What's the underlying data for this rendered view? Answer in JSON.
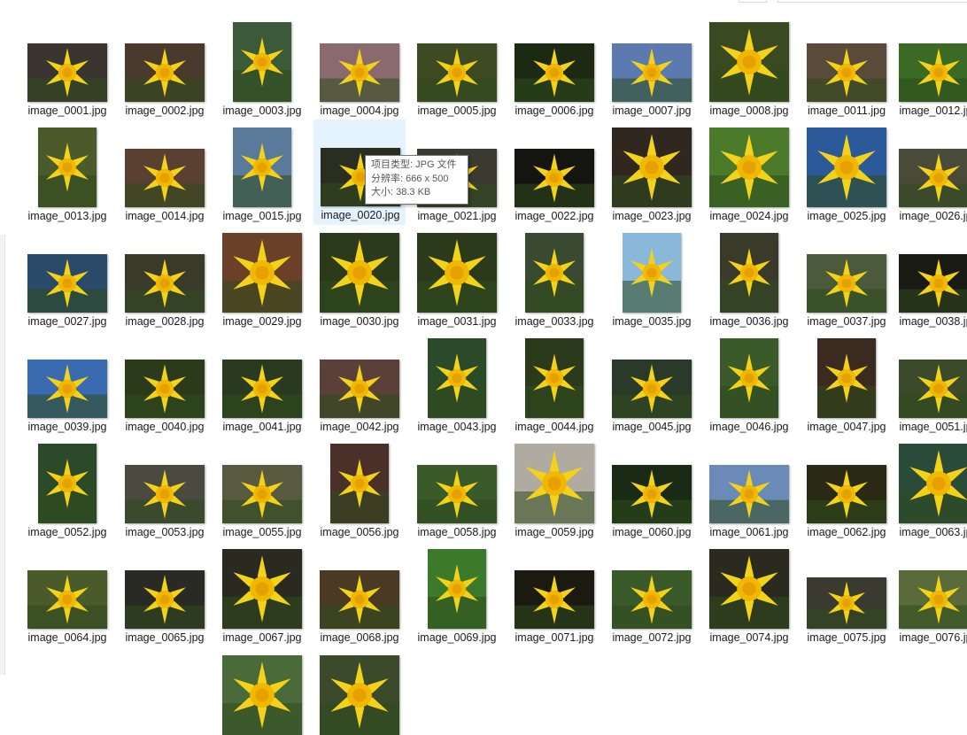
{
  "files": [
    {
      "name": "image_0001.jpg",
      "bg": "#3a3530",
      "thumb": "l"
    },
    {
      "name": "image_0002.jpg",
      "bg": "#4a3a2e",
      "thumb": "l"
    },
    {
      "name": "image_0003.jpg",
      "bg": "#3c5a3a",
      "thumb": "p"
    },
    {
      "name": "image_0004.jpg",
      "bg": "#8a6a6e",
      "thumb": "l"
    },
    {
      "name": "image_0005.jpg",
      "bg": "#3e4a22",
      "thumb": "l"
    },
    {
      "name": "image_0006.jpg",
      "bg": "#1c2a14",
      "thumb": "l"
    },
    {
      "name": "image_0007.jpg",
      "bg": "#5a7ab0",
      "thumb": "l"
    },
    {
      "name": "image_0008.jpg",
      "bg": "#3a4a20",
      "thumb": "sq"
    },
    {
      "name": "image_0011.jpg",
      "bg": "#5a4a3a",
      "thumb": "l"
    },
    {
      "name": "image_0012.jpg",
      "bg": "#3a6a24",
      "thumb": "l"
    },
    {
      "name": "image_0013.jpg",
      "bg": "#4a5a2a",
      "thumb": "p"
    },
    {
      "name": "image_0014.jpg",
      "bg": "#5a4030",
      "thumb": "l"
    },
    {
      "name": "image_0015.jpg",
      "bg": "#5a7a9a",
      "thumb": "p"
    },
    {
      "name": "image_0020.jpg",
      "bg": "#2a2e20",
      "thumb": "l"
    },
    {
      "name": "image_0021.jpg",
      "bg": "#3a3a30",
      "thumb": "l"
    },
    {
      "name": "image_0022.jpg",
      "bg": "#141410",
      "thumb": "l"
    },
    {
      "name": "image_0023.jpg",
      "bg": "#302820",
      "thumb": "sq"
    },
    {
      "name": "image_0024.jpg",
      "bg": "#4a7a2a",
      "thumb": "sq"
    },
    {
      "name": "image_0025.jpg",
      "bg": "#2a5a9a",
      "thumb": "sq"
    },
    {
      "name": "image_0026.jpg",
      "bg": "#4a4a3a",
      "thumb": "l"
    },
    {
      "name": "image_0027.jpg",
      "bg": "#2a4a6a",
      "thumb": "l"
    },
    {
      "name": "image_0028.jpg",
      "bg": "#3a3a2a",
      "thumb": "l"
    },
    {
      "name": "image_0029.jpg",
      "bg": "#6a4028",
      "thumb": "sq"
    },
    {
      "name": "image_0030.jpg",
      "bg": "#2a3a1a",
      "thumb": "sq"
    },
    {
      "name": "image_0031.jpg",
      "bg": "#2a3a1a",
      "thumb": "sq"
    },
    {
      "name": "image_0033.jpg",
      "bg": "#3a4a30",
      "thumb": "p"
    },
    {
      "name": "image_0035.jpg",
      "bg": "#8ab8d8",
      "thumb": "p"
    },
    {
      "name": "image_0036.jpg",
      "bg": "#3a3a2a",
      "thumb": "p"
    },
    {
      "name": "image_0037.jpg",
      "bg": "#4a5a3a",
      "thumb": "l"
    },
    {
      "name": "image_0038.jpg",
      "bg": "#1a1a14",
      "thumb": "l"
    },
    {
      "name": "image_0039.jpg",
      "bg": "#3a6ab0",
      "thumb": "l"
    },
    {
      "name": "image_0040.jpg",
      "bg": "#2a3a1a",
      "thumb": "l"
    },
    {
      "name": "image_0041.jpg",
      "bg": "#2a3a20",
      "thumb": "l"
    },
    {
      "name": "image_0042.jpg",
      "bg": "#5a4038",
      "thumb": "l"
    },
    {
      "name": "image_0043.jpg",
      "bg": "#2a4a2a",
      "thumb": "p"
    },
    {
      "name": "image_0044.jpg",
      "bg": "#2a3a1a",
      "thumb": "p"
    },
    {
      "name": "image_0045.jpg",
      "bg": "#2a3a2a",
      "thumb": "l"
    },
    {
      "name": "image_0046.jpg",
      "bg": "#3a5a2a",
      "thumb": "p"
    },
    {
      "name": "image_0047.jpg",
      "bg": "#3a2a20",
      "thumb": "p"
    },
    {
      "name": "image_0051.jpg",
      "bg": "#3a4a2a",
      "thumb": "l"
    },
    {
      "name": "image_0052.jpg",
      "bg": "#2a4a2a",
      "thumb": "p"
    },
    {
      "name": "image_0053.jpg",
      "bg": "#4a4a40",
      "thumb": "l"
    },
    {
      "name": "image_0055.jpg",
      "bg": "#5a5a40",
      "thumb": "l"
    },
    {
      "name": "image_0056.jpg",
      "bg": "#4a3028",
      "thumb": "p"
    },
    {
      "name": "image_0058.jpg",
      "bg": "#3a5a2a",
      "thumb": "l"
    },
    {
      "name": "image_0059.jpg",
      "bg": "#b0aaa0",
      "thumb": "sq"
    },
    {
      "name": "image_0060.jpg",
      "bg": "#1a2a14",
      "thumb": "l"
    },
    {
      "name": "image_0061.jpg",
      "bg": "#6a8ab8",
      "thumb": "l"
    },
    {
      "name": "image_0062.jpg",
      "bg": "#2a2a14",
      "thumb": "l"
    },
    {
      "name": "image_0063.jpg",
      "bg": "#2a4a3a",
      "thumb": "sq"
    },
    {
      "name": "image_0064.jpg",
      "bg": "#4a5a2a",
      "thumb": "l"
    },
    {
      "name": "image_0065.jpg",
      "bg": "#2a2a24",
      "thumb": "l"
    },
    {
      "name": "image_0067.jpg",
      "bg": "#2a2a20",
      "thumb": "sq"
    },
    {
      "name": "image_0068.jpg",
      "bg": "#4a3a24",
      "thumb": "l"
    },
    {
      "name": "image_0069.jpg",
      "bg": "#3a7a2a",
      "thumb": "p"
    },
    {
      "name": "image_0071.jpg",
      "bg": "#1a1a10",
      "thumb": "l"
    },
    {
      "name": "image_0072.jpg",
      "bg": "#3a5a2a",
      "thumb": "l"
    },
    {
      "name": "image_0074.jpg",
      "bg": "#2a2a1e",
      "thumb": "sq"
    },
    {
      "name": "image_0075.jpg",
      "bg": "#3a3a30",
      "thumb": "lw"
    },
    {
      "name": "image_0076.jpg",
      "bg": "#5a6a3a",
      "thumb": "l"
    },
    {
      "name": "",
      "bg": "#4a6a3a",
      "thumb": "sq"
    },
    {
      "name": "",
      "bg": "#3a4a2a",
      "thumb": "sq"
    }
  ],
  "tooltip": {
    "type": "项目类型: JPG 文件",
    "resolution": "分辨率: 666 x 500",
    "size": "大小: 38.3 KB"
  },
  "selected_index": 13,
  "colors": {
    "petal": "#f2d21a",
    "trumpet": "#f0b800",
    "selection": "#e5f3ff"
  }
}
